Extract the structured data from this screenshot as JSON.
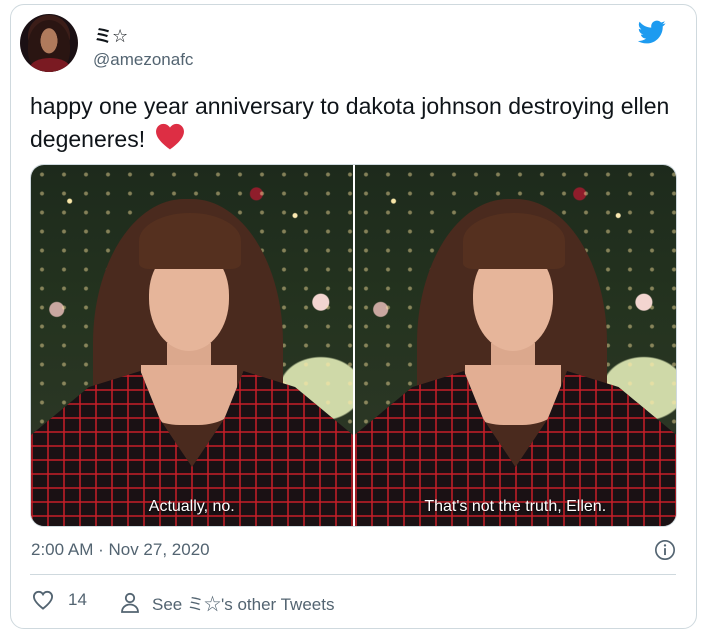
{
  "user": {
    "display_name": "ミ☆",
    "handle": "@amezonafc"
  },
  "tweet": {
    "text": "happy one year anniversary to dakota johnson destroying ellen degeneres!",
    "emoji": "heart",
    "media": [
      {
        "caption": "Actually, no."
      },
      {
        "caption": "That's not the truth, Ellen."
      }
    ],
    "timestamp": "2:00 AM · Nov 27, 2020"
  },
  "actions": {
    "like_count": "14",
    "see_more_label": "See ミ☆'s other Tweets"
  },
  "icons": [
    "twitter-bird-icon",
    "heart-icon",
    "info-icon",
    "person-icon",
    "red-heart-emoji-icon"
  ],
  "colors": {
    "brand_blue": "#1d9bf0",
    "secondary_text": "#536471",
    "border": "#cfd9de",
    "emoji_red": "#dd2e44"
  }
}
